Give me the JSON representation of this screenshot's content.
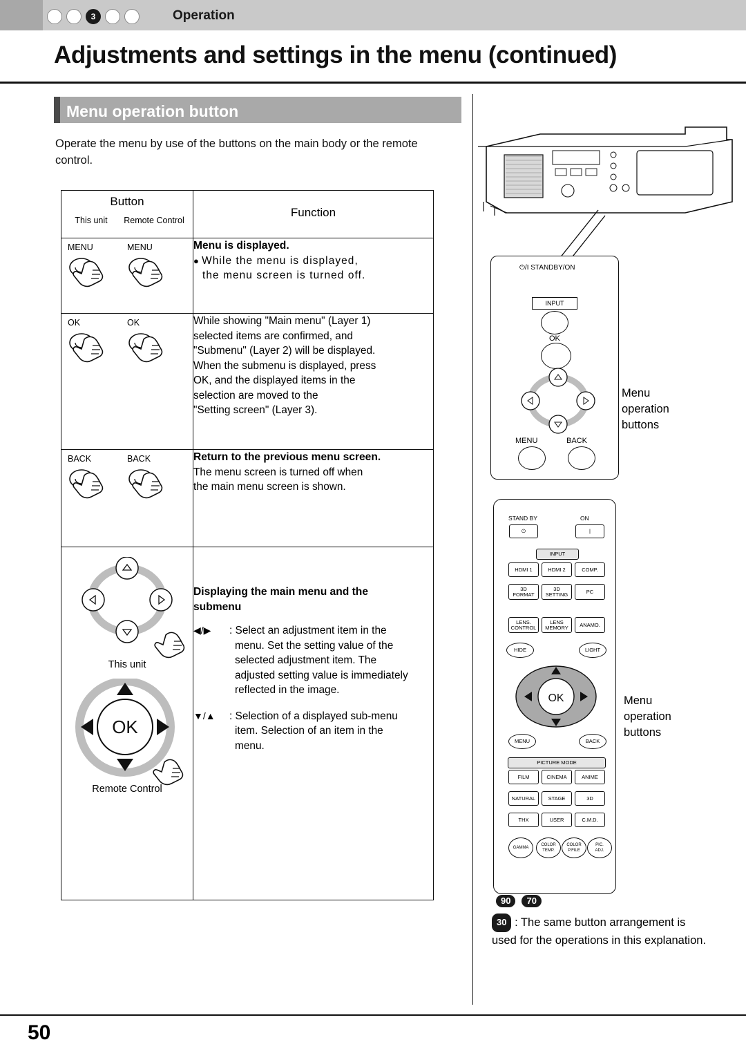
{
  "header": {
    "chapter_number": "3",
    "chapter_label": "Operation",
    "dots": [
      "",
      "",
      "3",
      "",
      ""
    ]
  },
  "page_title": "Adjustments and settings in the menu (continued)",
  "section_title": "Menu operation button",
  "intro": "Operate the menu by use of the buttons on the main body or the remote control.",
  "table": {
    "header": {
      "button": "Button",
      "function": "Function",
      "this_unit": "This unit",
      "remote_control": "Remote Control"
    },
    "rows": [
      {
        "button_left": "MENU",
        "button_right": "MENU",
        "function_title": "Menu is displayed.",
        "function_bullet": "While the menu is displayed,",
        "function_bullet2": "the menu screen is turned off."
      },
      {
        "button_left": "OK",
        "button_right": "OK",
        "function_lines": [
          "While showing \"Main menu\" (Layer 1)",
          "selected items are confirmed, and",
          "\"Submenu\" (Layer 2) will be displayed.",
          "When the submenu is displayed, press",
          "OK, and the displayed items in the",
          "selection are moved to the",
          "\"Setting screen\" (Layer 3)."
        ]
      },
      {
        "button_left": "BACK",
        "button_right": "BACK",
        "function_title": "Return to the previous menu screen.",
        "function_lines": [
          "The menu screen is turned off when",
          "the main menu screen is shown."
        ]
      },
      {
        "caption_unit": "This unit",
        "caption_remote": "Remote Control",
        "function_title_1": "Displaying the main menu and the",
        "function_title_2": "submenu",
        "item1_keys": "◀/▶",
        "item1_lines": [
          ": Select an adjustment item in the",
          "menu. Set the setting value of the",
          "selected adjustment item. The",
          "adjusted setting value is immediately",
          "reflected in the image."
        ],
        "item2_keys": "▼/▲",
        "item2_lines": [
          ": Selection of a displayed sub-menu",
          "item. Selection of an item in the",
          "menu."
        ]
      }
    ]
  },
  "right": {
    "projector_labels": {
      "standby_on": "⏻/I STANDBY/ON",
      "input": "INPUT",
      "ok": "OK",
      "menu": "MENU",
      "back": "BACK"
    },
    "callout_unit": [
      "Menu",
      "operation",
      "buttons"
    ],
    "callout_remote": [
      "Menu",
      "operation",
      "buttons"
    ],
    "remote_keys": {
      "standby": "STAND BY",
      "on": "ON",
      "input": "INPUT",
      "hdmi1": "HDMI 1",
      "hdmi2": "HDMI 2",
      "comp": "COMP.",
      "format3d_1": "3D",
      "format3d_2": "FORMAT",
      "setting3d_1": "3D",
      "setting3d_2": "SETTING",
      "pc": "PC",
      "lens_control_1": "LENS.",
      "lens_control_2": "CONTROL",
      "lens_memory_1": "LENS",
      "lens_memory_2": "MEMORY",
      "anamo": "ANAMO.",
      "hide": "HIDE",
      "light": "LIGHT",
      "ok": "OK",
      "menu": "MENU",
      "back": "BACK",
      "picture_mode": "PICTURE MODE",
      "film": "FILM",
      "cinema": "CINEMA",
      "anime": "ANIME",
      "natural": "NATURAL",
      "stage": "STAGE",
      "three_d": "3D",
      "thx": "THX",
      "user": "USER",
      "cmd": "C.M.D.",
      "gamma": "GAMMA",
      "color_temp_1": "COLOR",
      "color_temp_2": "TEMP.",
      "color_pfile_1": "COLOR",
      "color_pfile_2": "P.FILE",
      "pic_adj_1": "PIC.",
      "pic_adj_2": "ADJ."
    },
    "model_badges": [
      "90",
      "70"
    ],
    "note_badge": "30",
    "note_text": ": The same button arrangement is used for the operations in this explanation."
  },
  "page_number": "50"
}
